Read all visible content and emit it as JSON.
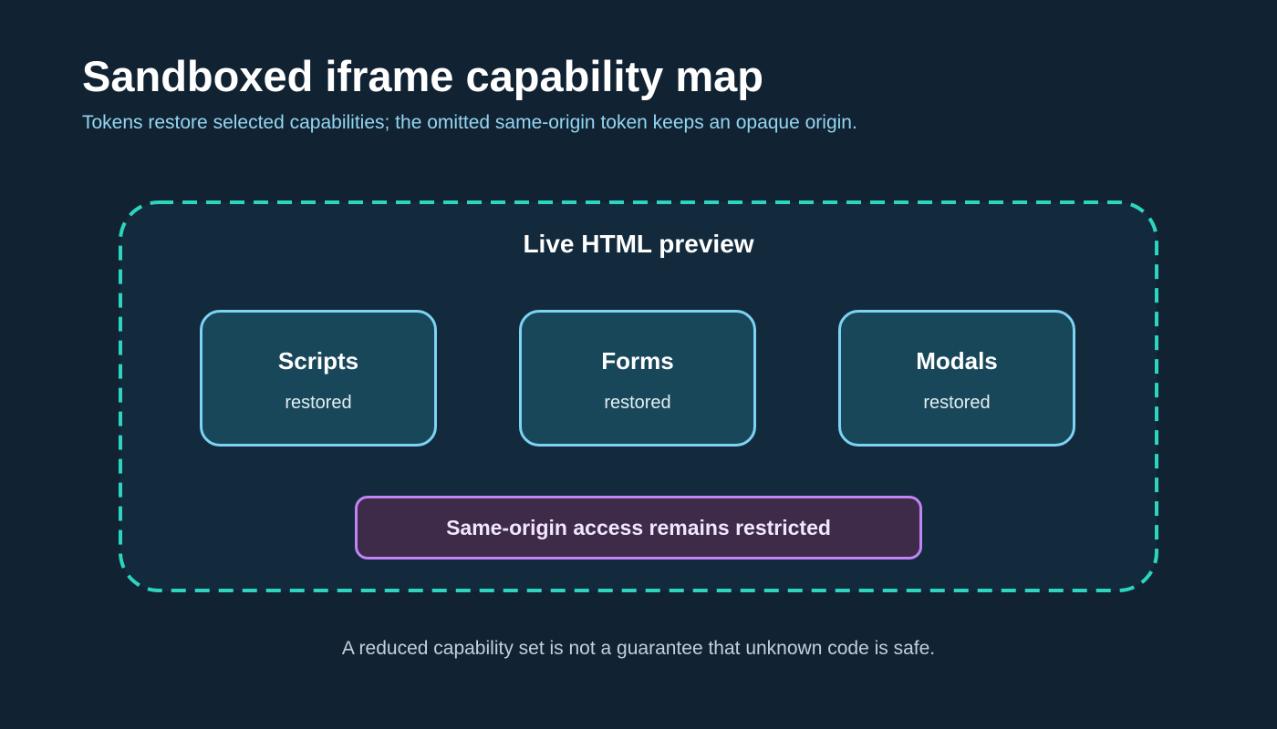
{
  "header": {
    "title": "Sandboxed iframe capability map",
    "subtitle": "Tokens restore selected capabilities; the omitted same-origin token keeps an opaque origin."
  },
  "frame": {
    "label": "Live HTML preview",
    "capabilities": [
      {
        "name": "Scripts",
        "status": "restored"
      },
      {
        "name": "Forms",
        "status": "restored"
      },
      {
        "name": "Modals",
        "status": "restored"
      }
    ],
    "restriction": "Same-origin access remains restricted"
  },
  "footer": {
    "note": "A reduced capability set is not a guarantee that unknown code is safe."
  },
  "colors": {
    "background": "#112233",
    "frame_border": "#2dd4bf",
    "card_border": "#7dd3f4",
    "restriction_border": "#c084f5"
  }
}
